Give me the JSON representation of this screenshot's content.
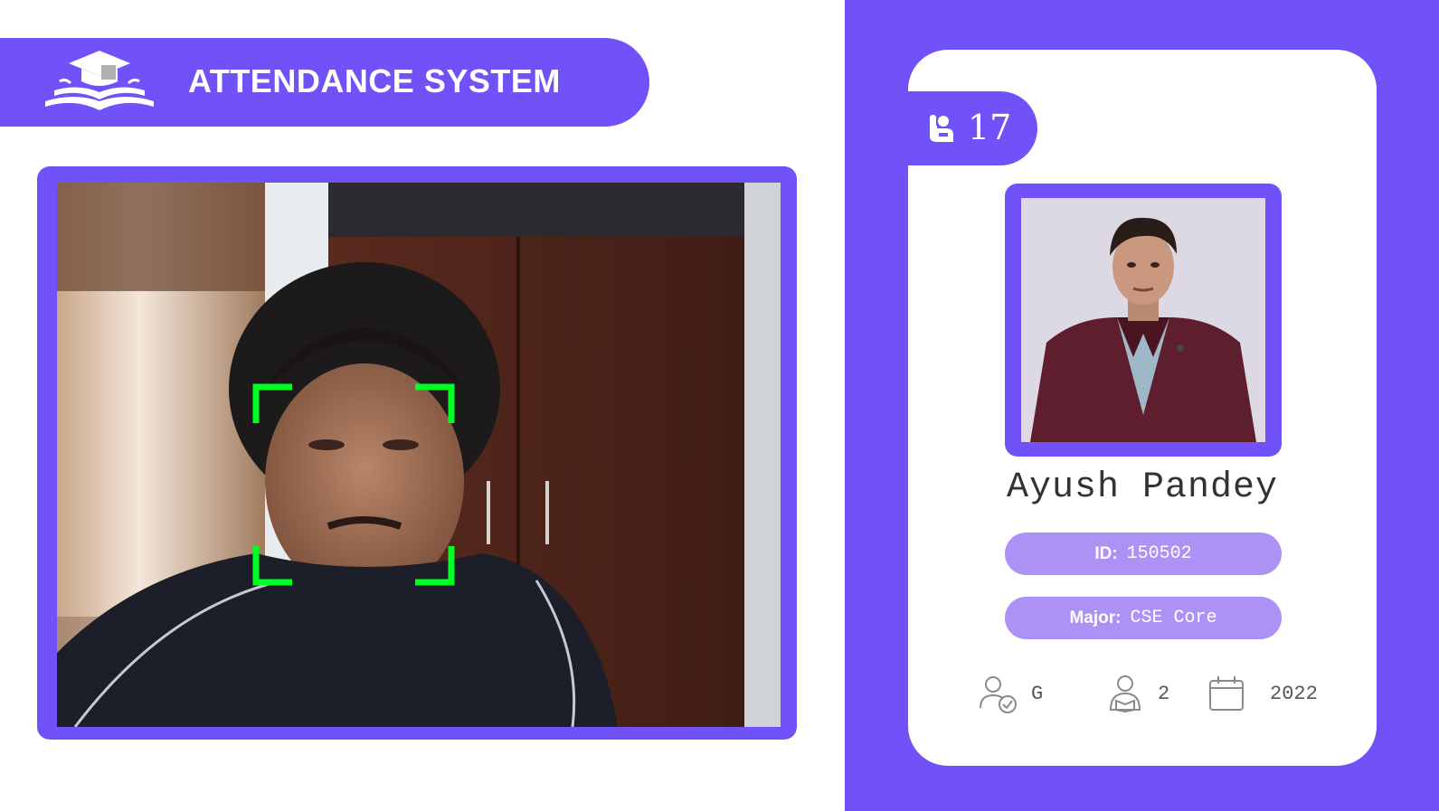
{
  "app": {
    "title": "ATTENDANCE SYSTEM",
    "logo_icon": "graduation-cap-book-icon"
  },
  "colors": {
    "accent": "#7052f8",
    "pill": "#ad92f5",
    "face_box": "#00ff22",
    "background": "#ffffff"
  },
  "webcam": {
    "detection_icon": "face-detection-brackets-icon"
  },
  "student": {
    "total_attendance": "17",
    "attendance_icon": "raised-hand-icon",
    "name": "Ayush Pandey",
    "id_label": "ID:",
    "id_value": "150502",
    "major_label": "Major:",
    "major_value": "CSE Core",
    "standing_icon": "user-check-icon",
    "standing": "G",
    "year_icon": "student-reading-icon",
    "year": "2",
    "starting_year_icon": "calendar-icon",
    "starting_year": "2022"
  }
}
